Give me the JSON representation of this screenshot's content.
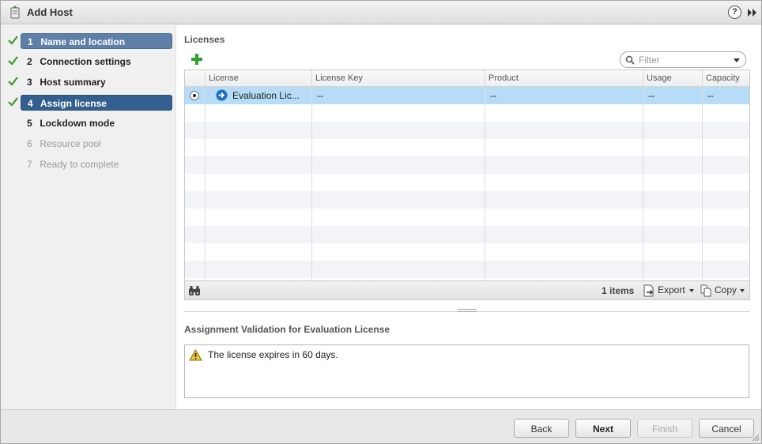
{
  "window": {
    "title": "Add Host",
    "help_label": "?"
  },
  "steps": [
    {
      "num": "1",
      "label": "Name and location",
      "state": "done-selected",
      "checked": true
    },
    {
      "num": "2",
      "label": "Connection settings",
      "state": "done",
      "checked": true
    },
    {
      "num": "3",
      "label": "Host summary",
      "state": "done",
      "checked": true
    },
    {
      "num": "4",
      "label": "Assign license",
      "state": "current",
      "checked": true
    },
    {
      "num": "5",
      "label": "Lockdown mode",
      "state": "normal",
      "checked": false
    },
    {
      "num": "6",
      "label": "Resource pool",
      "state": "disabled",
      "checked": false
    },
    {
      "num": "7",
      "label": "Ready to complete",
      "state": "disabled",
      "checked": false
    }
  ],
  "licenses": {
    "title": "Licenses",
    "filter_placeholder": "Filter",
    "columns": [
      "License",
      "License Key",
      "Product",
      "Usage",
      "Capacity"
    ],
    "rows": [
      {
        "license": "Evaluation Lic...",
        "license_key": "--",
        "product": "--",
        "usage": "--",
        "capacity": "--",
        "selected": true
      }
    ],
    "items_count": "1 items",
    "export_label": "Export",
    "copy_label": "Copy"
  },
  "validation": {
    "title": "Assignment Validation for Evaluation License",
    "message": "The license expires in 60 days."
  },
  "buttons": {
    "back": "Back",
    "next": "Next",
    "finish": "Finish",
    "cancel": "Cancel"
  },
  "colors": {
    "selected_row": "#b6dcf7",
    "current_step": "#325f8e",
    "completed_step_selected": "#5d7fa8",
    "check_green": "#3a9a2a",
    "add_green": "#2ea12e"
  }
}
